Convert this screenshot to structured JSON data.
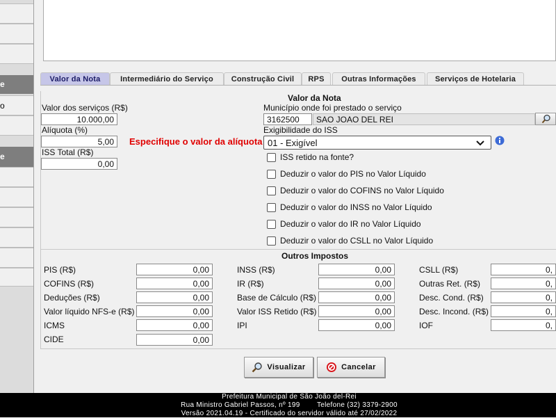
{
  "sidebar": {
    "items": [
      {
        "label": ""
      },
      {
        "label": ""
      },
      {
        "label": "e"
      },
      {
        "label": "o"
      },
      {
        "label": "e"
      }
    ]
  },
  "tabs": [
    {
      "label": "Valor da Nota",
      "active": true
    },
    {
      "label": "Intermediário do Serviço"
    },
    {
      "label": "Construção Civil"
    },
    {
      "label": "RPS"
    },
    {
      "label": "Outras Informações"
    },
    {
      "label": "Serviços de Hotelaria"
    }
  ],
  "valor_nota": {
    "section_title": "Valor da Nota",
    "valor_servicos_label": "Valor dos serviços (R$)",
    "valor_servicos_value": "10.000,00",
    "aliquota_label": "Alíquota (%)",
    "aliquota_value": "5,00",
    "aliquota_warning": "Especifique o valor da alíquota",
    "iss_total_label": "ISS Total (R$)",
    "iss_total_value": "0,00",
    "municipio_label": "Município onde foi prestado o serviço",
    "municipio_code": "3162500",
    "municipio_name": "SAO JOAO DEL REI",
    "exigibilidade_label": "Exigibilidade do ISS",
    "exigibilidade_value": "01 - Exigível",
    "checkboxes": [
      "ISS retido na fonte?",
      "Deduzir o valor do PIS no Valor Líquido",
      "Deduzir o valor do COFINS no Valor Líquido",
      "Deduzir o valor do INSS no Valor Líquido",
      "Deduzir o valor do IR no Valor Líquido",
      "Deduzir o valor do CSLL no Valor Líquido"
    ]
  },
  "outros_impostos": {
    "section_title": "Outros Impostos",
    "col1": [
      {
        "label": "PIS (R$)",
        "value": "0,00"
      },
      {
        "label": "COFINS (R$)",
        "value": "0,00"
      },
      {
        "label": "Deduções (R$)",
        "value": "0,00"
      },
      {
        "label": "Valor líquido NFS-e (R$)",
        "value": "0,00"
      },
      {
        "label": "ICMS",
        "value": "0,00"
      },
      {
        "label": "CIDE",
        "value": "0,00"
      }
    ],
    "col2": [
      {
        "label": "INSS (R$)",
        "value": "0,00"
      },
      {
        "label": "IR (R$)",
        "value": "0,00"
      },
      {
        "label": "Base de Cálculo (R$)",
        "value": "0,00"
      },
      {
        "label": "Valor ISS Retido (R$)",
        "value": "0,00"
      },
      {
        "label": "IPI",
        "value": "0,00"
      }
    ],
    "col3": [
      {
        "label": "CSLL (R$)",
        "value": "0,"
      },
      {
        "label": "Outras Ret. (R$)",
        "value": "0,"
      },
      {
        "label": "Desc. Cond. (R$)",
        "value": "0,"
      },
      {
        "label": "Desc. Incond. (R$)",
        "value": "0,"
      },
      {
        "label": "IOF",
        "value": "0,"
      }
    ]
  },
  "actions": {
    "visualizar_label": "Visualizar",
    "cancelar_label": "Cancelar"
  },
  "footer": {
    "line1": "Prefeitura Municipal de São João del-Rei",
    "line2": "Rua Ministro Gabriel Passos, nº 199        Telefone (32) 3379-2900",
    "line3": "Versão 2021.04.19 - Certificado do servidor válido até 27/02/2022"
  },
  "colors": {
    "warning": "#e00000",
    "active_tab": "#c6c6e8",
    "info_icon": "#3d6bd6",
    "cancel_icon": "#d8141a"
  }
}
